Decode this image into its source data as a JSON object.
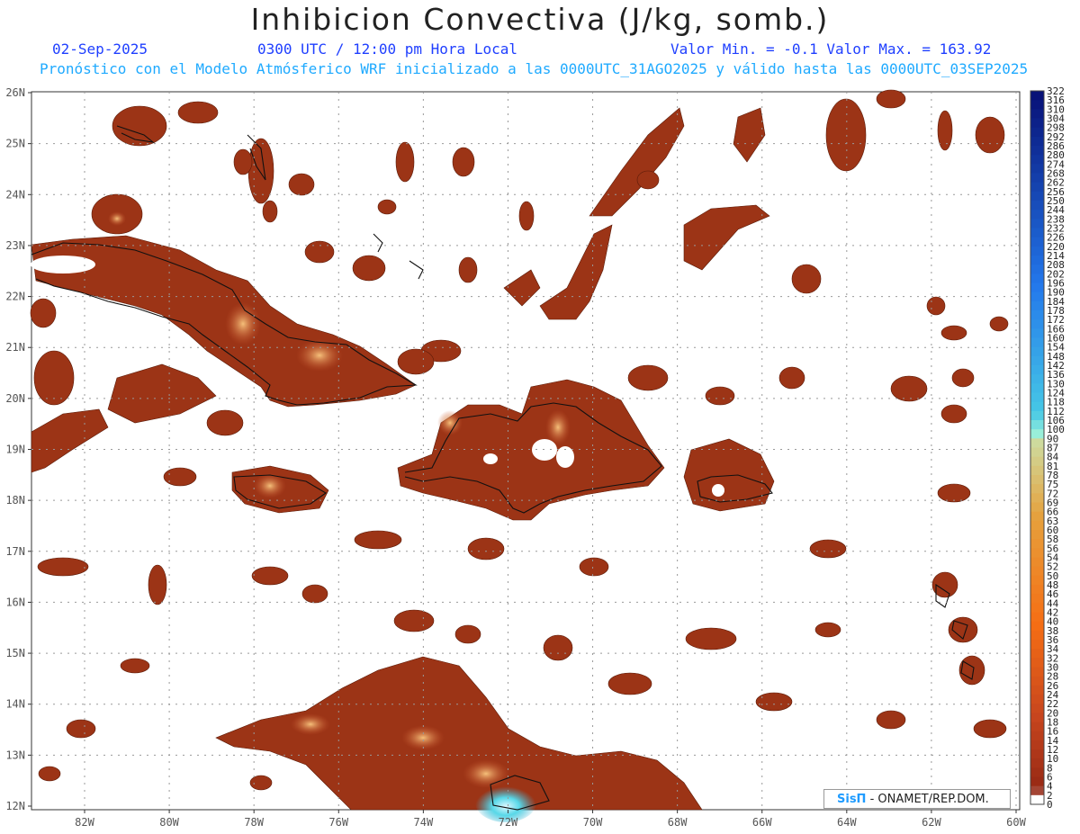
{
  "header": {
    "title": "Inhibicion Convectiva (J/kg, somb.)",
    "date": "02-Sep-2025",
    "time": "0300 UTC / 12:00 pm Hora Local",
    "min_max": "Valor Min. = -0.1  Valor Max. = 163.92",
    "forecast_info": "Pronóstico con el Modelo Atmósferico WRF inicializado a las 0000UTC_31AGO2025 y válido hasta las  0000UTC_03SEP2025"
  },
  "map": {
    "lat_labels": [
      "26N",
      "25N",
      "24N",
      "23N",
      "22N",
      "21N",
      "20N",
      "19N",
      "18N",
      "17N",
      "16N",
      "15N",
      "14N",
      "13N",
      "12N"
    ],
    "lon_labels": [
      "82W",
      "80W",
      "78W",
      "76W",
      "74W",
      "72W",
      "70W",
      "68W",
      "66W",
      "64W",
      "62W",
      "60W"
    ],
    "fill_color": "#9c3416",
    "coast_color": "#111111",
    "grid": true
  },
  "colorbar": {
    "labels": [
      "322",
      "316",
      "310",
      "304",
      "298",
      "292",
      "286",
      "280",
      "274",
      "268",
      "262",
      "256",
      "250",
      "244",
      "238",
      "232",
      "226",
      "220",
      "214",
      "208",
      "202",
      "196",
      "190",
      "184",
      "178",
      "172",
      "166",
      "160",
      "154",
      "148",
      "142",
      "136",
      "130",
      "124",
      "118",
      "112",
      "106",
      "100",
      "90",
      "87",
      "84",
      "81",
      "78",
      "75",
      "72",
      "69",
      "66",
      "63",
      "60",
      "58",
      "56",
      "54",
      "52",
      "50",
      "48",
      "46",
      "44",
      "42",
      "40",
      "38",
      "36",
      "34",
      "32",
      "30",
      "28",
      "26",
      "24",
      "22",
      "20",
      "18",
      "16",
      "14",
      "12",
      "10",
      "8",
      "6",
      "4",
      "2",
      "0"
    ]
  },
  "credit": {
    "brand": "SisΠ",
    "text": " - ONAMET/REP.DOM."
  }
}
